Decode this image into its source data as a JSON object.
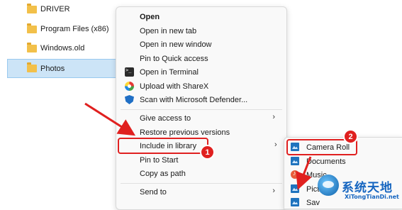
{
  "files": [
    {
      "name": "DRIVER"
    },
    {
      "name": "Program Files (x86)"
    },
    {
      "name": "Windows.old"
    },
    {
      "name": "Photos"
    }
  ],
  "context_menu": {
    "items": [
      {
        "label": "Open"
      },
      {
        "label": "Open in new tab"
      },
      {
        "label": "Open in new window"
      },
      {
        "label": "Pin to Quick access"
      },
      {
        "label": "Open in Terminal"
      },
      {
        "label": "Upload with ShareX"
      },
      {
        "label": "Scan with Microsoft Defender..."
      },
      {
        "label": "Give access to"
      },
      {
        "label": "Restore previous versions"
      },
      {
        "label": "Include in library"
      },
      {
        "label": "Pin to Start"
      },
      {
        "label": "Copy as path"
      },
      {
        "label": "Send to"
      }
    ]
  },
  "submenu": {
    "items": [
      {
        "label": "Camera Roll"
      },
      {
        "label": "Documents"
      },
      {
        "label": "Music"
      },
      {
        "label": "Pict"
      },
      {
        "label": "Sav"
      }
    ]
  },
  "annotations": {
    "badge_1": "1",
    "badge_2": "2",
    "color": "#e0201f"
  },
  "watermark": {
    "text_cn": "系统天地",
    "text_en": "XiTongTianDi.net"
  }
}
